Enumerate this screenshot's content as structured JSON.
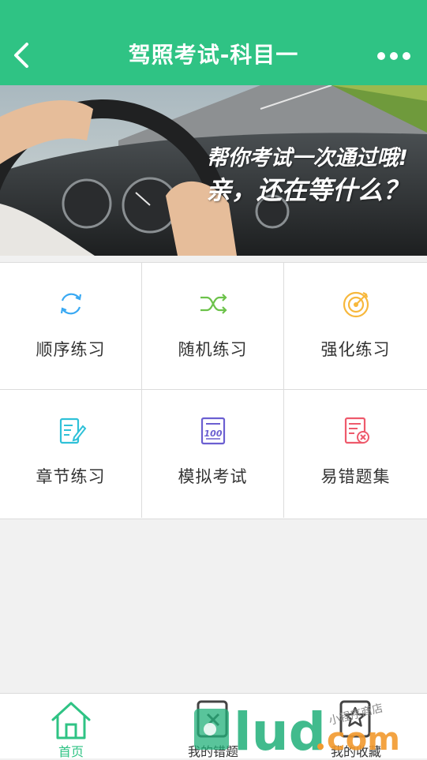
{
  "header": {
    "title": "驾照考试-科目一",
    "back_icon": "chevron-left-icon",
    "more_icon": "more-dots-icon",
    "bg_color": "#2fc384"
  },
  "banner": {
    "line1": "帮你考试一次通过哦!",
    "line2": "亲，还在等什么？"
  },
  "menu": {
    "items": [
      {
        "label": "顺序练习",
        "icon": "refresh-icon",
        "color": "#39a9f3"
      },
      {
        "label": "随机练习",
        "icon": "shuffle-icon",
        "color": "#6cc24a"
      },
      {
        "label": "强化练习",
        "icon": "target-icon",
        "color": "#f7b83d"
      },
      {
        "label": "章节练习",
        "icon": "document-edit-icon",
        "color": "#2fc1d8"
      },
      {
        "label": "模拟考试",
        "icon": "exam-score-icon",
        "color": "#6b5fd1"
      },
      {
        "label": "易错题集",
        "icon": "error-doc-icon",
        "color": "#ee5a6c"
      }
    ]
  },
  "tabbar": {
    "tabs": [
      {
        "label": "首页",
        "icon": "home-icon",
        "active": true
      },
      {
        "label": "我的错题",
        "icon": "wrong-book-icon",
        "active": false
      },
      {
        "label": "我的收藏",
        "icon": "star-doc-icon",
        "active": false
      }
    ]
  },
  "watermark": {
    "text": "lud.com",
    "tagline": "小程序商店"
  },
  "colors": {
    "accent": "#2fc384",
    "text": "#333333",
    "background": "#f1f1f1"
  }
}
